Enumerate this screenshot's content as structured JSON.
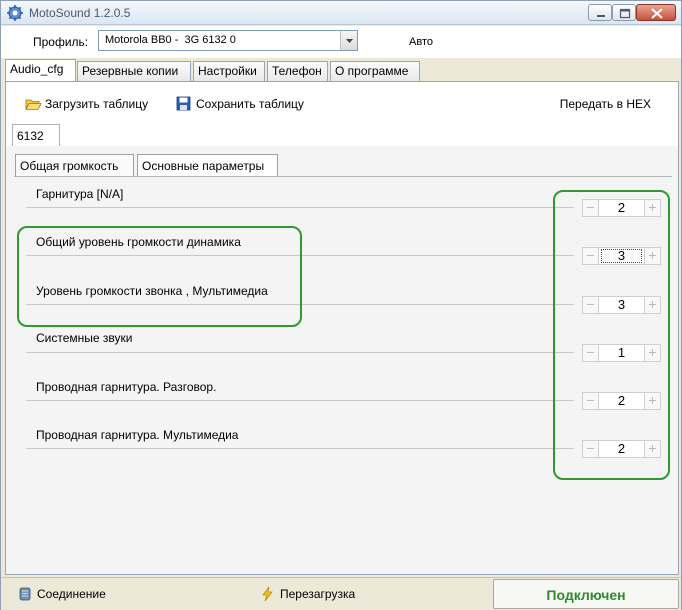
{
  "window": {
    "title": "MotoSound 1.2.0.5",
    "icon": "gear-icon"
  },
  "profile": {
    "label": "Профиль:",
    "selected": "Motorola BB0 -  3G 6132 0",
    "mode": "Авто"
  },
  "tabs": [
    {
      "label": "Audio_cfg",
      "active": true
    },
    {
      "label": "Резервные копии",
      "active": false
    },
    {
      "label": "Настройки",
      "active": false
    },
    {
      "label": "Телефон",
      "active": false
    },
    {
      "label": "О программе",
      "active": false
    }
  ],
  "toolbar": {
    "load_label": "Загрузить таблицу",
    "load_icon": "folder-open-icon",
    "save_label": "Сохранить таблицу",
    "save_icon": "floppy-disk-icon",
    "hex_label": "Передать в HEX"
  },
  "model_tab": "6132",
  "subtabs": [
    {
      "label": "Общая громкость",
      "active": false
    },
    {
      "label": "Основные параметры",
      "active": true
    }
  ],
  "params": [
    {
      "label": "Гарнитура [N/A]",
      "value": "2",
      "focused": false
    },
    {
      "label": "Общий уровень громкости динамика",
      "value": "3",
      "focused": true
    },
    {
      "label": "Уровень громкости звонка , Мультимедиа",
      "value": "3",
      "focused": false
    },
    {
      "label": "Системные звуки",
      "value": "1",
      "focused": false
    },
    {
      "label": "Проводная гарнитура. Разговор.",
      "value": "2",
      "focused": false
    },
    {
      "label": "Проводная гарнитура. Мультимедиа",
      "value": "2",
      "focused": false
    }
  ],
  "spinner_symbols": {
    "minus": "−",
    "plus": "+"
  },
  "status": {
    "connection_label": "Соединение",
    "connection_icon": "connection-icon",
    "reboot_label": "Перезагрузка",
    "reboot_icon": "lightning-icon",
    "state_label": "Подключен",
    "state_color": "#2e8b2e"
  },
  "colors": {
    "highlight_box": "#2f9a2f"
  }
}
